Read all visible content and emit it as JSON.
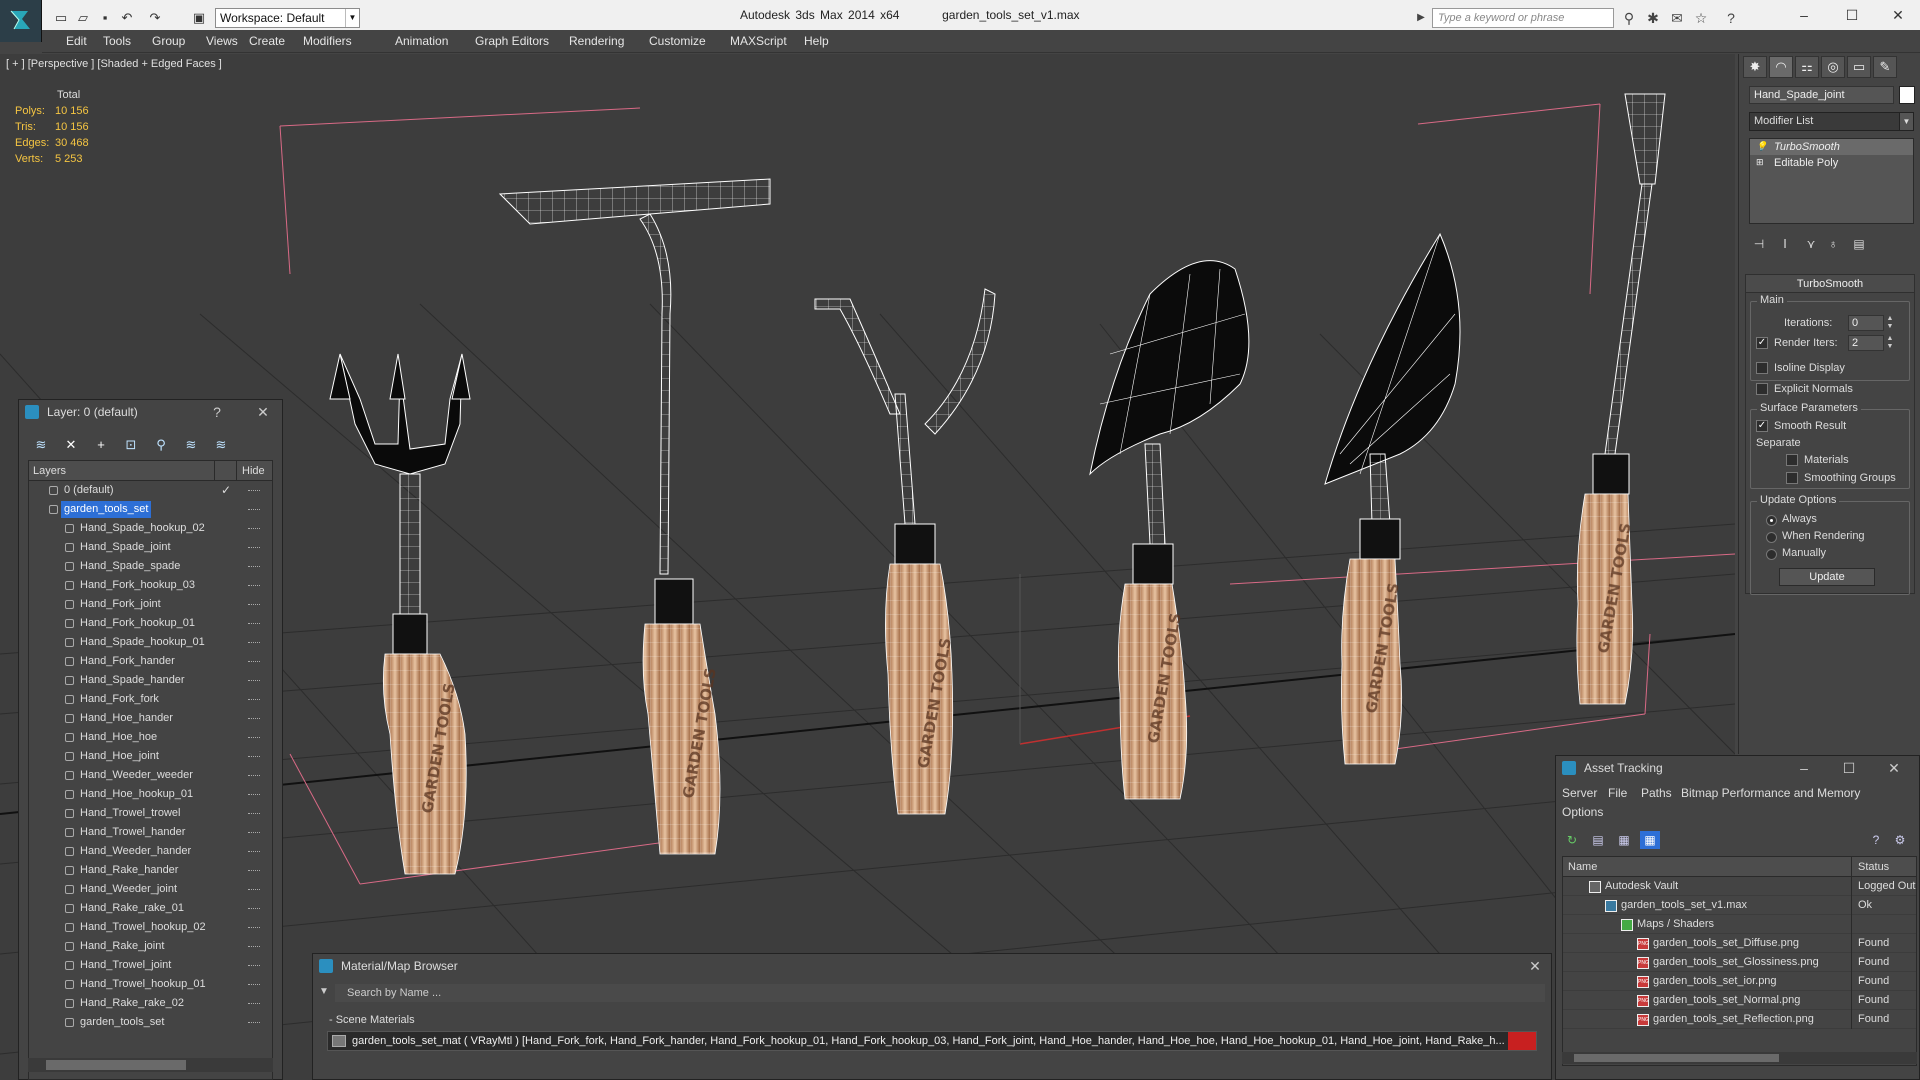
{
  "titlebar": {
    "workspace": "Workspace: Default",
    "app_name": "Autodesk 3ds Max  2014 x64",
    "file_name": "garden_tools_set_v1.max",
    "search_placeholder": "Type a keyword or phrase"
  },
  "menu": [
    "Edit",
    "Tools",
    "Group",
    "Views",
    "Create",
    "Modifiers",
    "Animation",
    "Graph Editors",
    "Rendering",
    "Customize",
    "MAXScript",
    "Help"
  ],
  "viewport": {
    "label": "[ + ] [Perspective ] [Shaded + Edged Faces ]",
    "stats": {
      "header": "Total",
      "polys_label": "Polys:",
      "polys": "10 156",
      "tris_label": "Tris:",
      "tris": "10 156",
      "edges_label": "Edges:",
      "edges": "30 468",
      "verts_label": "Verts:",
      "verts": "5 253"
    },
    "handle_text": "GARDEN TOOLS"
  },
  "command_panel": {
    "object_name": "Hand_Spade_joint",
    "object_color": "#ffffff",
    "modifier_list": "Modifier List",
    "stack": [
      "TurboSmooth",
      "Editable Poly"
    ],
    "rollout_title": "TurboSmooth",
    "main_group": "Main",
    "iterations_label": "Iterations:",
    "iterations": "0",
    "render_iters_label": "Render Iters:",
    "render_iters": "2",
    "render_iters_checked": true,
    "isoline": "Isoline Display",
    "explicit_normals": "Explicit Normals",
    "surface_group": "Surface Parameters",
    "smooth_result": "Smooth Result",
    "separate": "Separate",
    "materials": "Materials",
    "smoothing_groups": "Smoothing Groups",
    "update_group": "Update Options",
    "always": "Always",
    "when_rendering": "When Rendering",
    "manually": "Manually",
    "update_button": "Update"
  },
  "layer_panel": {
    "title": "Layer: 0 (default)",
    "help": "?",
    "col_layers": "Layers",
    "col_hide": "Hide",
    "rows": [
      {
        "name": "0 (default)",
        "level": 0,
        "type": "layer",
        "selected": false,
        "current": true
      },
      {
        "name": "garden_tools_set",
        "level": 0,
        "type": "layer",
        "selected": true,
        "current": false
      },
      {
        "name": "Hand_Spade_hookup_02",
        "level": 1,
        "type": "object"
      },
      {
        "name": "Hand_Spade_joint",
        "level": 1,
        "type": "object"
      },
      {
        "name": "Hand_Spade_spade",
        "level": 1,
        "type": "object"
      },
      {
        "name": "Hand_Fork_hookup_03",
        "level": 1,
        "type": "object"
      },
      {
        "name": "Hand_Fork_joint",
        "level": 1,
        "type": "object"
      },
      {
        "name": "Hand_Fork_hookup_01",
        "level": 1,
        "type": "object"
      },
      {
        "name": "Hand_Spade_hookup_01",
        "level": 1,
        "type": "object"
      },
      {
        "name": "Hand_Fork_hander",
        "level": 1,
        "type": "object"
      },
      {
        "name": "Hand_Spade_hander",
        "level": 1,
        "type": "object"
      },
      {
        "name": "Hand_Fork_fork",
        "level": 1,
        "type": "object"
      },
      {
        "name": "Hand_Hoe_hander",
        "level": 1,
        "type": "object"
      },
      {
        "name": "Hand_Hoe_hoe",
        "level": 1,
        "type": "object"
      },
      {
        "name": "Hand_Hoe_joint",
        "level": 1,
        "type": "object"
      },
      {
        "name": "Hand_Weeder_weeder",
        "level": 1,
        "type": "object"
      },
      {
        "name": "Hand_Hoe_hookup_01",
        "level": 1,
        "type": "object"
      },
      {
        "name": "Hand_Trowel_trowel",
        "level": 1,
        "type": "object"
      },
      {
        "name": "Hand_Trowel_hander",
        "level": 1,
        "type": "object"
      },
      {
        "name": "Hand_Weeder_hander",
        "level": 1,
        "type": "object"
      },
      {
        "name": "Hand_Rake_hander",
        "level": 1,
        "type": "object"
      },
      {
        "name": "Hand_Weeder_joint",
        "level": 1,
        "type": "object"
      },
      {
        "name": "Hand_Rake_rake_01",
        "level": 1,
        "type": "object"
      },
      {
        "name": "Hand_Trowel_hookup_02",
        "level": 1,
        "type": "object"
      },
      {
        "name": "Hand_Rake_joint",
        "level": 1,
        "type": "object"
      },
      {
        "name": "Hand_Trowel_joint",
        "level": 1,
        "type": "object"
      },
      {
        "name": "Hand_Trowel_hookup_01",
        "level": 1,
        "type": "object"
      },
      {
        "name": "Hand_Rake_rake_02",
        "level": 1,
        "type": "object"
      },
      {
        "name": "garden_tools_set",
        "level": 1,
        "type": "object"
      }
    ]
  },
  "material_browser": {
    "title": "Material/Map Browser",
    "search_placeholder": "Search by Name ...",
    "section": "- Scene Materials",
    "material_row": "garden_tools_set_mat ( VRayMtl ) [Hand_Fork_fork, Hand_Fork_hander, Hand_Fork_hookup_01, Hand_Fork_hookup_03, Hand_Fork_joint, Hand_Hoe_hander, Hand_Hoe_hoe, Hand_Hoe_hookup_01, Hand_Hoe_joint, Hand_Rake_h..."
  },
  "asset_tracking": {
    "title": "Asset Tracking",
    "menu": [
      "Server",
      "File",
      "Paths",
      "Bitmap Performance and Memory",
      "Options"
    ],
    "col_name": "Name",
    "col_status": "Status",
    "rows": [
      {
        "name": "Autodesk Vault",
        "status": "Logged Out",
        "indent": 0,
        "icon": "vault"
      },
      {
        "name": "garden_tools_set_v1.max",
        "status": "Ok",
        "indent": 1,
        "icon": "max"
      },
      {
        "name": "Maps / Shaders",
        "status": "",
        "indent": 2,
        "icon": "maps"
      },
      {
        "name": "garden_tools_set_Diffuse.png",
        "status": "Found",
        "indent": 3,
        "icon": "png"
      },
      {
        "name": "garden_tools_set_Glossiness.png",
        "status": "Found",
        "indent": 3,
        "icon": "png"
      },
      {
        "name": "garden_tools_set_ior.png",
        "status": "Found",
        "indent": 3,
        "icon": "png"
      },
      {
        "name": "garden_tools_set_Normal.png",
        "status": "Found",
        "indent": 3,
        "icon": "png"
      },
      {
        "name": "garden_tools_set_Reflection.png",
        "status": "Found",
        "indent": 3,
        "icon": "png"
      }
    ]
  }
}
